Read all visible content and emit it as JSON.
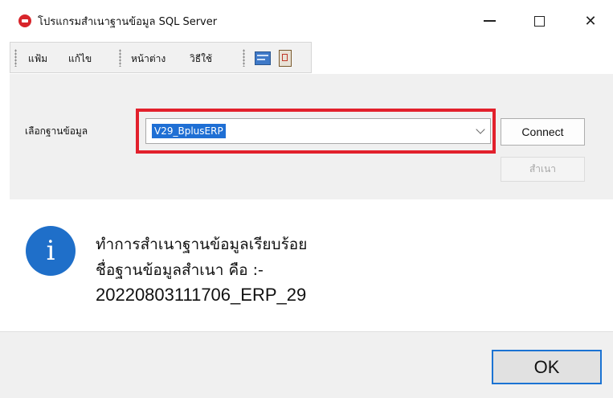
{
  "window": {
    "title": "โปรแกรมสำเนาฐานข้อมูล SQL Server",
    "icon": "app-icon",
    "controls": {
      "minimize": "minimize",
      "maximize": "maximize",
      "close": "✕"
    }
  },
  "menu": {
    "items": [
      "แฟ้ม",
      "แก้ไข",
      "หน้าต่าง",
      "วิธีใช้"
    ],
    "toolbar_icons": [
      "window-icon",
      "clipboard-icon"
    ]
  },
  "form": {
    "db_label": "เลือกฐานข้อมูล",
    "db_value": "V29_BplusERP",
    "connect_label": "Connect",
    "copy_label": "สำเนา",
    "highlight_color": "#e2202c"
  },
  "message": {
    "icon": "info-icon",
    "line1": "ทำการสำเนาฐานข้อมูลเรียบร้อย",
    "line2": "ชื่อฐานข้อมูลสำเนา คือ :-",
    "line3": "20220803111706_ERP_29"
  },
  "footer": {
    "ok_label": "OK"
  },
  "colors": {
    "accent": "#1f6fc9",
    "selection": "#1f6fd4",
    "ok_border": "#1b73d3"
  }
}
